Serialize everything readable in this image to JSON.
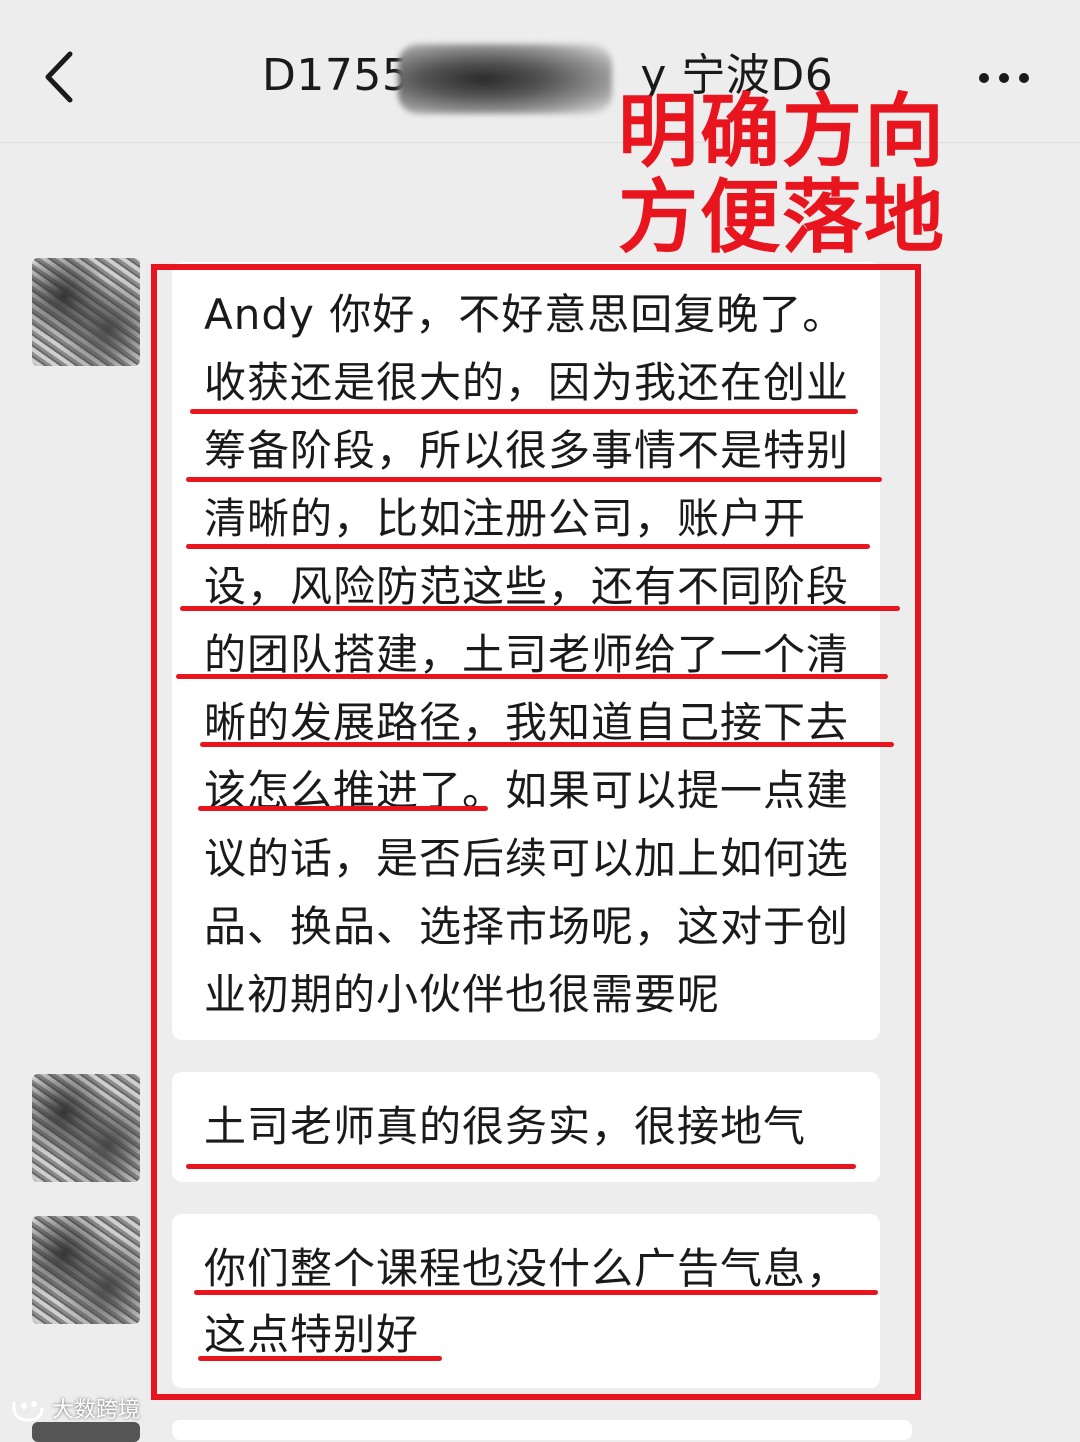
{
  "header": {
    "title_prefix": "D1755",
    "title_suffix": "y 宁波D6",
    "back_icon": "chevron-left-icon",
    "more_icon": "more-dots-icon"
  },
  "annotation": {
    "line1": "明确方向",
    "line2": "方便落地",
    "color": "#e8141e"
  },
  "messages": [
    {
      "lines": [
        "Andy 你好，不好意思回复晚了。",
        "收获还是很大的，因为我还在创业",
        "筹备阶段，所以很多事情不是特别",
        "清晰的，比如注册公司，账户开",
        "设，风险防范这些，还有不同阶段",
        "的团队搭建，土司老师给了一个清",
        "晰的发展路径，我知道自己接下去",
        "该怎么推进了。如果可以提一点建",
        "议的话，是否后续可以加上如何选",
        "品、换品、选择市场呢，这对于创",
        "业初期的小伙伴也很需要呢"
      ]
    },
    {
      "lines": [
        "土司老师真的很务实，很接地气"
      ]
    },
    {
      "lines": [
        "你们整个课程也没什么广告气息，",
        "这点特别好"
      ]
    }
  ],
  "watermark": {
    "text": "大数跨境"
  },
  "colors": {
    "background": "#ededed",
    "bubble": "#ffffff",
    "highlight": "#e8141e"
  }
}
